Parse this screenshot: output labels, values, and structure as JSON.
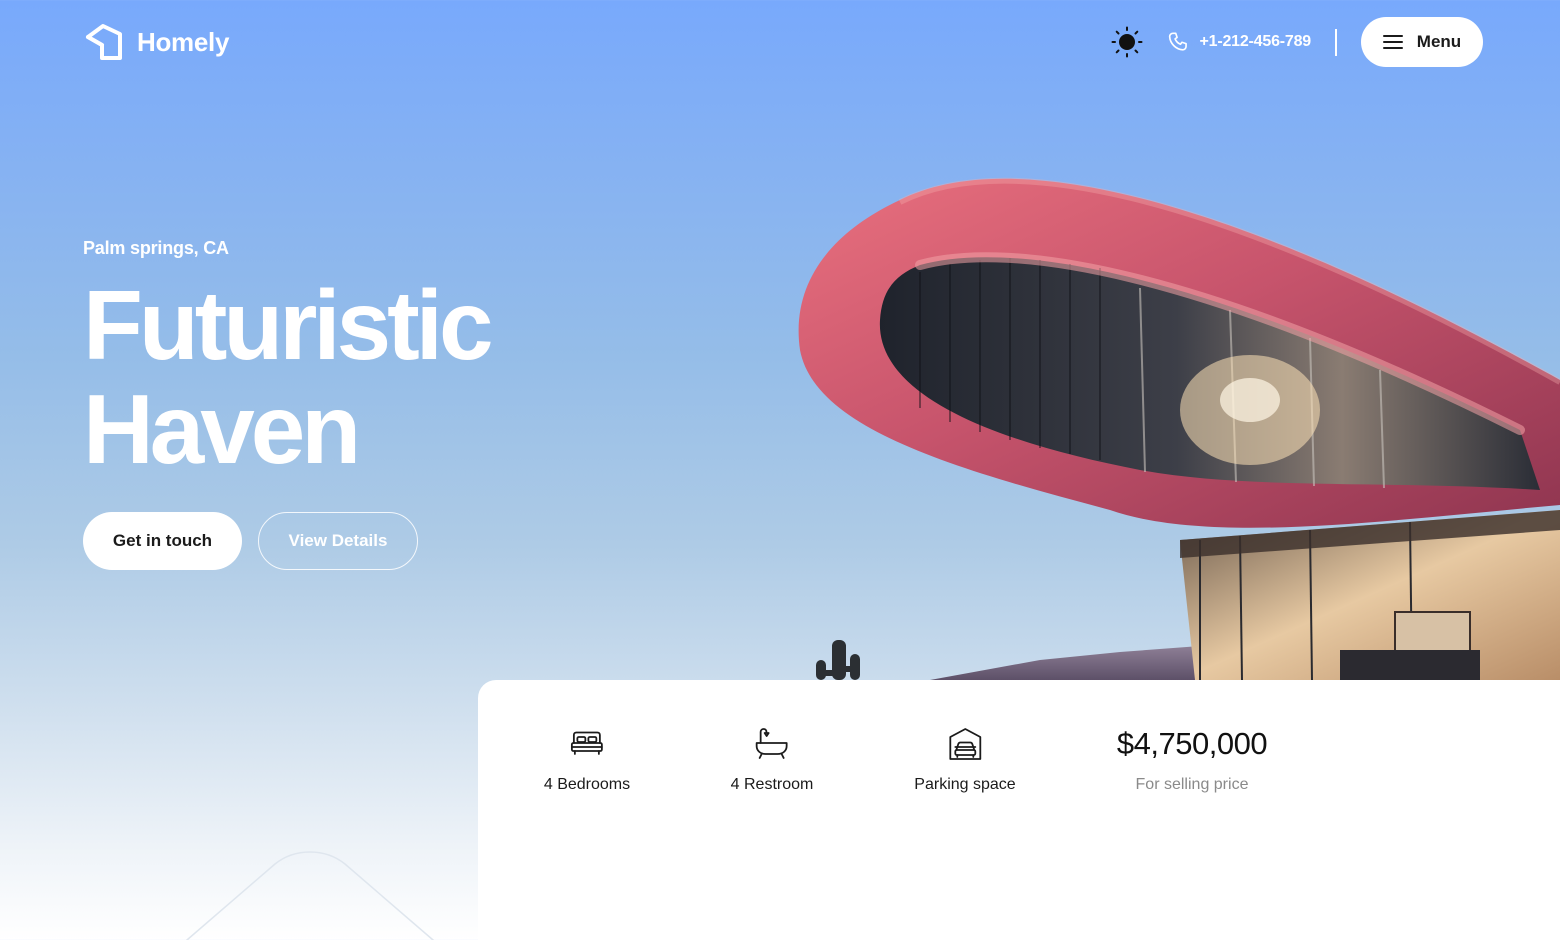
{
  "brand": {
    "name": "Homely",
    "logo_icon": "house-outline-icon",
    "accent": "#78a9fc"
  },
  "header": {
    "theme_icon": "sun-icon",
    "phone_icon": "phone-icon",
    "phone": "+1-212-456-789",
    "menu_icon": "hamburger-icon",
    "menu_label": "Menu"
  },
  "hero": {
    "location": "Palm springs, CA",
    "title_line1": "Futuristic",
    "title_line2": "Haven",
    "primary_cta": "Get in touch",
    "secondary_cta": "View Details"
  },
  "stats": {
    "items": [
      {
        "icon": "bed-icon",
        "label": "4 Bedrooms"
      },
      {
        "icon": "bathtub-icon",
        "label": "4 Restroom"
      },
      {
        "icon": "garage-icon",
        "label": "Parking space"
      }
    ],
    "price": "$4,750,000",
    "price_caption": "For selling price"
  },
  "colors": {
    "building_pink": "#c7546c",
    "text_dark": "#1b1b1b",
    "muted": "#8a8a8a"
  }
}
